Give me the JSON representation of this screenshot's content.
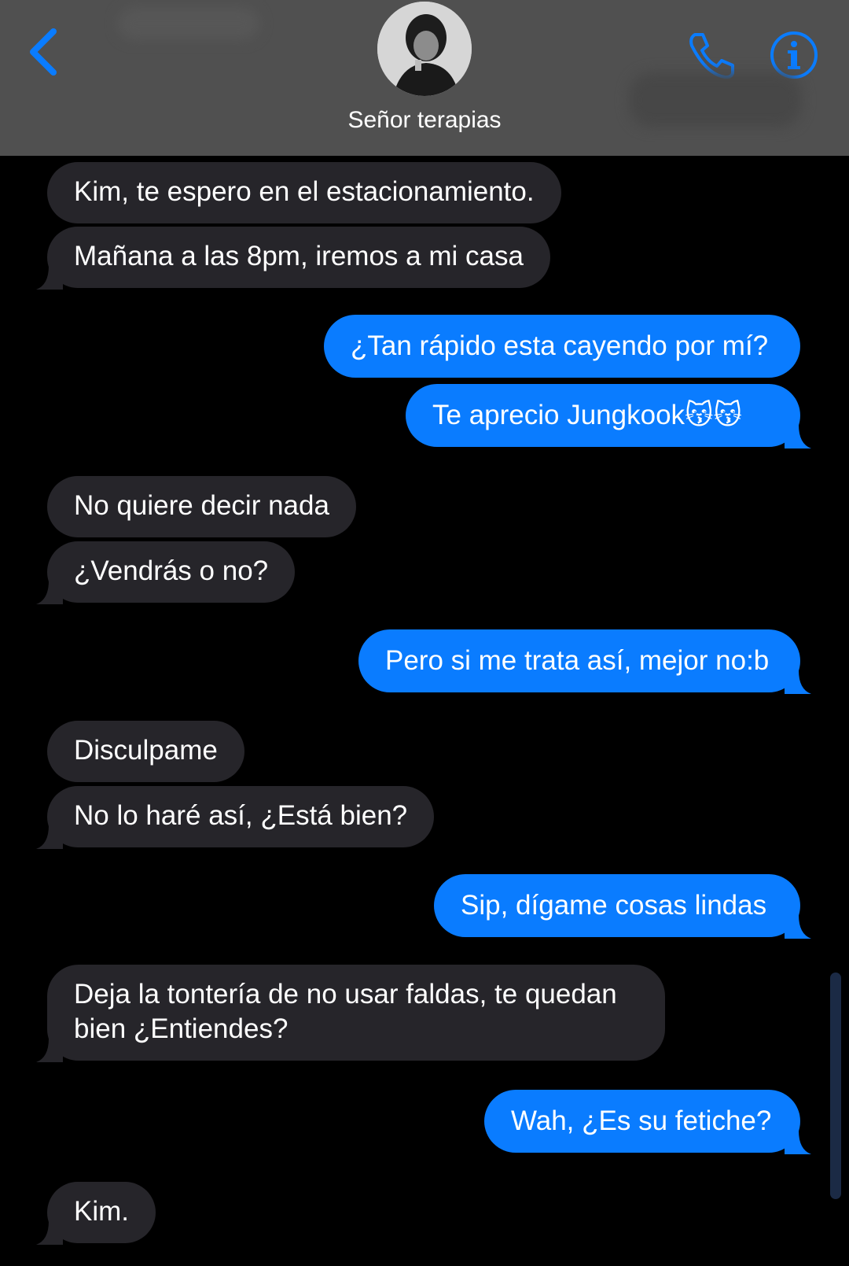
{
  "header": {
    "contact_name": "Señor terapias",
    "back_icon": "chevron-left-icon",
    "phone_icon": "phone-icon",
    "info_icon": "info-icon",
    "accent": "#0a7cff"
  },
  "messages": [
    {
      "side": "received",
      "text": "Kim, te espero en el estacionamiento."
    },
    {
      "side": "received",
      "text": "Mañana a las 8pm, iremos a mi casa"
    },
    {
      "side": "sent",
      "text": "¿Tan rápido esta cayendo por mí?"
    },
    {
      "side": "sent",
      "text": "Te aprecio Jungkook😽😽"
    },
    {
      "side": "received",
      "text": "No quiere decir nada"
    },
    {
      "side": "received",
      "text": "¿Vendrás o no?"
    },
    {
      "side": "sent",
      "text": "Pero si me trata así, mejor no:b"
    },
    {
      "side": "received",
      "text": "Disculpame"
    },
    {
      "side": "received",
      "text": "No lo haré así, ¿Está bien?"
    },
    {
      "side": "sent",
      "text": "Sip, dígame cosas lindas"
    },
    {
      "side": "received",
      "text": "Deja la tontería de no usar faldas, te quedan bien ¿Entiendes?"
    },
    {
      "side": "sent",
      "text": "Wah, ¿Es su fetiche?"
    },
    {
      "side": "received",
      "text": "Kim."
    }
  ],
  "colors": {
    "header_bg": "#505050",
    "received_bubble": "#26252a",
    "sent_bubble": "#0a7cff",
    "background": "#000000"
  }
}
